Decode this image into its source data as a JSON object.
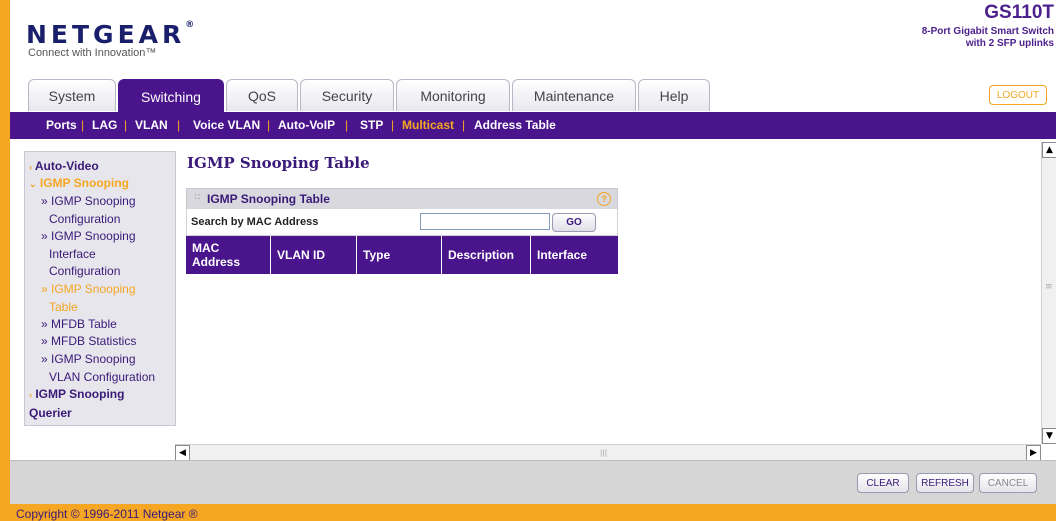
{
  "header": {
    "logo_text": "NETGEAR",
    "logo_reg": "®",
    "tagline": "Connect with Innovation™",
    "model": "GS110T",
    "model_desc_line1": "8-Port Gigabit Smart Switch",
    "model_desc_line2": "with 2 SFP uplinks",
    "logout_label": "LOGOUT"
  },
  "tabs": [
    {
      "label": "System"
    },
    {
      "label": "Switching",
      "active": true
    },
    {
      "label": "QoS"
    },
    {
      "label": "Security"
    },
    {
      "label": "Monitoring"
    },
    {
      "label": "Maintenance"
    },
    {
      "label": "Help"
    }
  ],
  "subnav": {
    "items": [
      "Ports",
      "LAG",
      "VLAN",
      "Voice VLAN",
      "Auto-VoIP",
      "STP",
      "Multicast",
      "Address Table"
    ],
    "active": "Multicast",
    "separator": "|"
  },
  "sidebar": {
    "auto_video": "Auto-Video",
    "igmp_snooping": "IGMP Snooping",
    "igmp_snooping_config_1": "» IGMP Snooping",
    "igmp_snooping_config_2": "Configuration",
    "igmp_snooping_iface_1": "» IGMP Snooping",
    "igmp_snooping_iface_2": "Interface",
    "igmp_snooping_iface_3": "Configuration",
    "igmp_snooping_table_1": "» IGMP Snooping",
    "igmp_snooping_table_2": "Table",
    "mfdb_table": "» MFDB Table",
    "mfdb_statistics": "» MFDB Statistics",
    "igmp_vlan_1": "» IGMP Snooping",
    "igmp_vlan_2": "VLAN Configuration",
    "querier_1": "IGMP Snooping",
    "querier_2": "Querier",
    "closed_marker": "›",
    "open_marker": "»"
  },
  "main": {
    "page_title": "IGMP Snooping Table",
    "panel_title": "IGMP Snooping Table",
    "help_icon": "?",
    "search_label": "Search by MAC Address",
    "search_value": "",
    "go_label": "GO",
    "columns": [
      {
        "line1": "MAC",
        "line2": "Address"
      },
      {
        "line1": "VLAN ID",
        "line2": ""
      },
      {
        "line1": "Type",
        "line2": ""
      },
      {
        "line1": "Description",
        "line2": ""
      },
      {
        "line1": "Interface",
        "line2": ""
      }
    ]
  },
  "scrollbars": {
    "up": "▲",
    "down": "▼",
    "left": "◀",
    "right": "▶",
    "grip": "|||",
    "vgrip": "≡"
  },
  "actions": {
    "clear": "CLEAR",
    "refresh": "REFRESH",
    "cancel": "CANCEL"
  },
  "footer": {
    "copyright": "Copyright © 1996-2011 Netgear ®"
  },
  "colors": {
    "brand_purple": "#4a148c",
    "accent_orange": "#f5a623"
  }
}
